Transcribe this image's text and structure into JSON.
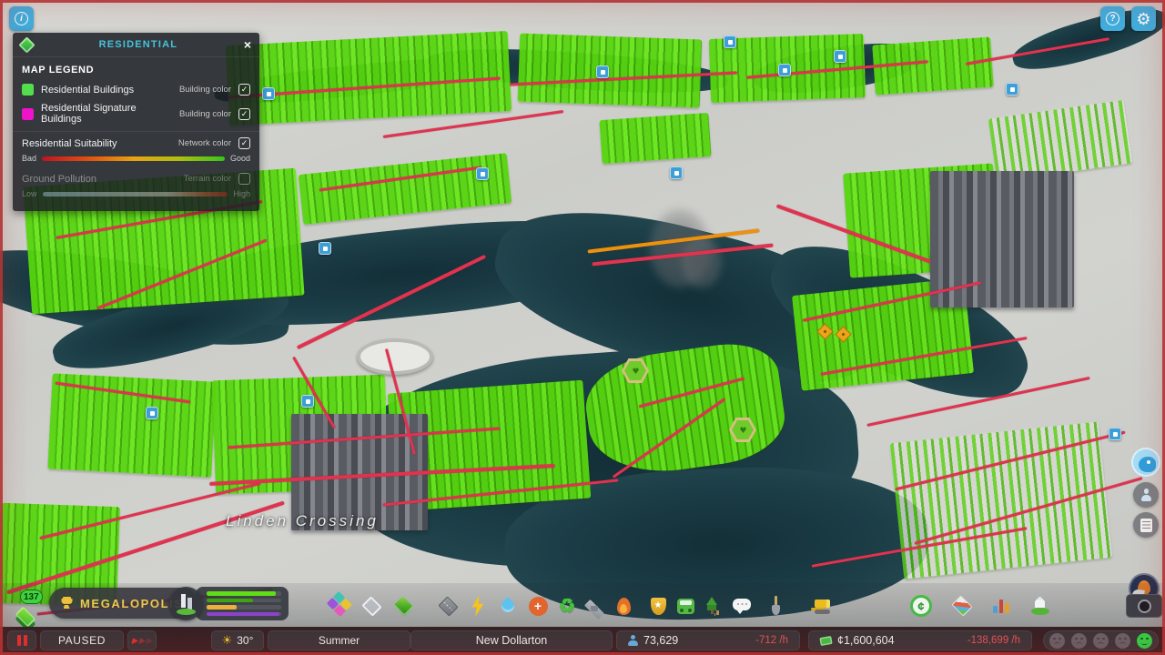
{
  "top_bar": {
    "info_glyph": "i",
    "help_glyph": "?",
    "gear_glyph": "⚙"
  },
  "legend_panel": {
    "title": "RESIDENTIAL",
    "close_glyph": "×",
    "section_title": "MAP LEGEND",
    "rows": [
      {
        "label": "Residential Buildings",
        "type_label": "Building color",
        "check": "✓",
        "swatch": "#52e04e"
      },
      {
        "label": "Residential Signature Buildings",
        "type_label": "Building color",
        "check": "✓",
        "swatch": "#ef14cd"
      },
      {
        "label": "Residential Suitability",
        "type_label": "Network color",
        "check": "✓",
        "scale_left": "Bad",
        "scale_right": "Good"
      },
      {
        "label": "Ground Pollution",
        "type_label": "Terrain color",
        "check": "",
        "scale_left": "Low",
        "scale_right": "High"
      }
    ]
  },
  "map": {
    "district_label": "Linden Crossing"
  },
  "toolbar": {
    "level_badge": "137",
    "milestone_label": "MEGALOPOLIS",
    "demand": {
      "bars": [
        {
          "name": "residential",
          "value": 93
        },
        {
          "name": "residential-medium",
          "value": 62
        },
        {
          "name": "commercial",
          "value": 40
        },
        {
          "name": "office",
          "value": 97
        }
      ]
    },
    "economy_glyph": "¢",
    "police_star": "★",
    "health_cross": "+",
    "recycle_glyph": "♻",
    "play_glyph": "▶"
  },
  "status_bar": {
    "sim_state": "PAUSED",
    "sun_glyph": "☀",
    "temperature": "30°",
    "season": "Summer",
    "city_name": "New Dollarton",
    "population": "73,629",
    "population_rate": "-712 /h",
    "money": "¢1,600,604",
    "money_rate": "-138,699 /h"
  }
}
